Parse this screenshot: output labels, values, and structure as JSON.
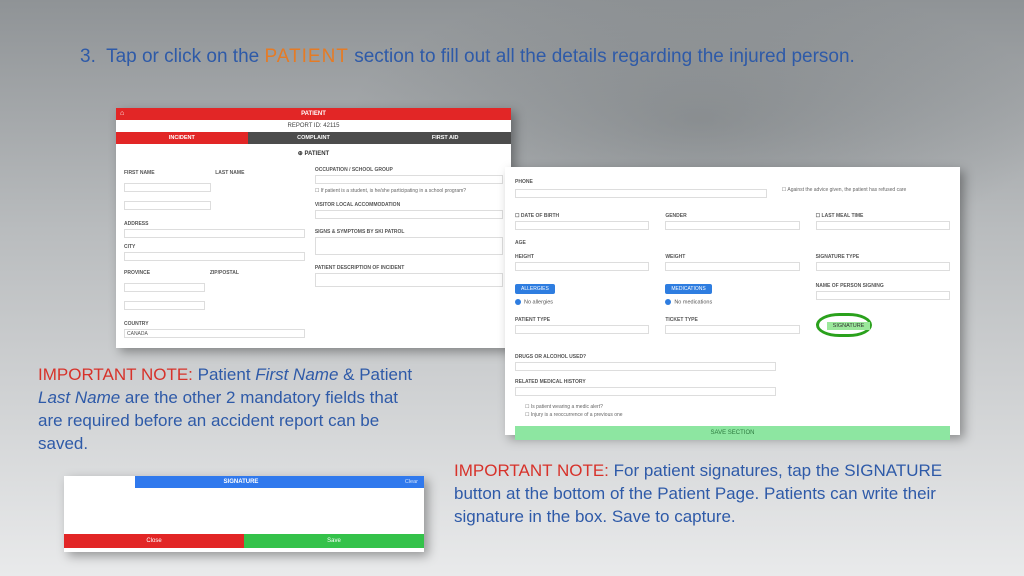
{
  "step": {
    "number": "3.",
    "pre": "Tap or click on the ",
    "keyword": "PATIENT",
    "post": " section to fill out all the details regarding the injured person."
  },
  "note1": {
    "lead": "IMPORTANT NOTE: ",
    "body_pre": "Patient ",
    "fn": "First Name",
    "amp": " & Patient ",
    "ln": "Last Name",
    "body_post": " are the other 2 mandatory fields that are required before an accident report can be saved."
  },
  "note2": {
    "lead": "IMPORTANT NOTE: ",
    "body": "For patient signatures, tap the SIGNATURE button at the bottom of the Patient Page. Patients can write their signature in the box. Save to capture."
  },
  "shot1": {
    "header": "PATIENT",
    "report": "REPORT ID: 42115",
    "tabs": [
      "INCIDENT",
      "COMPLAINT",
      "FIRST AID"
    ],
    "section": "⊕ PATIENT",
    "left": {
      "first_name": "FIRST NAME",
      "last_name": "LAST NAME",
      "address": "ADDRESS",
      "city": "CITY",
      "province": "PROVINCE",
      "zip": "ZIP/POSTAL",
      "country": "COUNTRY",
      "country_val": "CANADA"
    },
    "right": {
      "occupation": "OCCUPATION / SCHOOL GROUP",
      "student_q": "If patient is a student, is he/she participating in a school program?",
      "accom": "VISITOR LOCAL ACCOMMODATION",
      "signs": "SIGNS & SYMPTOMS BY SKI PATROL",
      "desc": "PATIENT DESCRIPTION OF INCIDENT"
    }
  },
  "shot2": {
    "phone": "PHONE",
    "refused": "Against the advice given, the patient has refused care",
    "dob": "DATE OF BIRTH",
    "gender": "GENDER",
    "meal": "LAST MEAL TIME",
    "age": "AGE",
    "height": "HEIGHT",
    "weight": "WEIGHT",
    "sig_type": "SIGNATURE TYPE",
    "allergies": "ALLERGIES",
    "no_allergies": "No allergies",
    "medications": "MEDICATIONS",
    "no_medications": "No medications",
    "signer": "NAME OF PERSON SIGNING",
    "patient_type": "PATIENT TYPE",
    "ticket_type": "TICKET TYPE",
    "sig_btn": "SIGNATURE",
    "drugs": "DRUGS OR ALCOHOL USED?",
    "history": "RELATED MEDICAL HISTORY",
    "ck1": "Is patient wearing a medic alert?",
    "ck2": "Injury is a reoccurrence of a previous one",
    "save": "SAVE SECTION"
  },
  "shot3": {
    "title": "SIGNATURE",
    "clear": "Clear",
    "close": "Close",
    "save": "Save"
  }
}
